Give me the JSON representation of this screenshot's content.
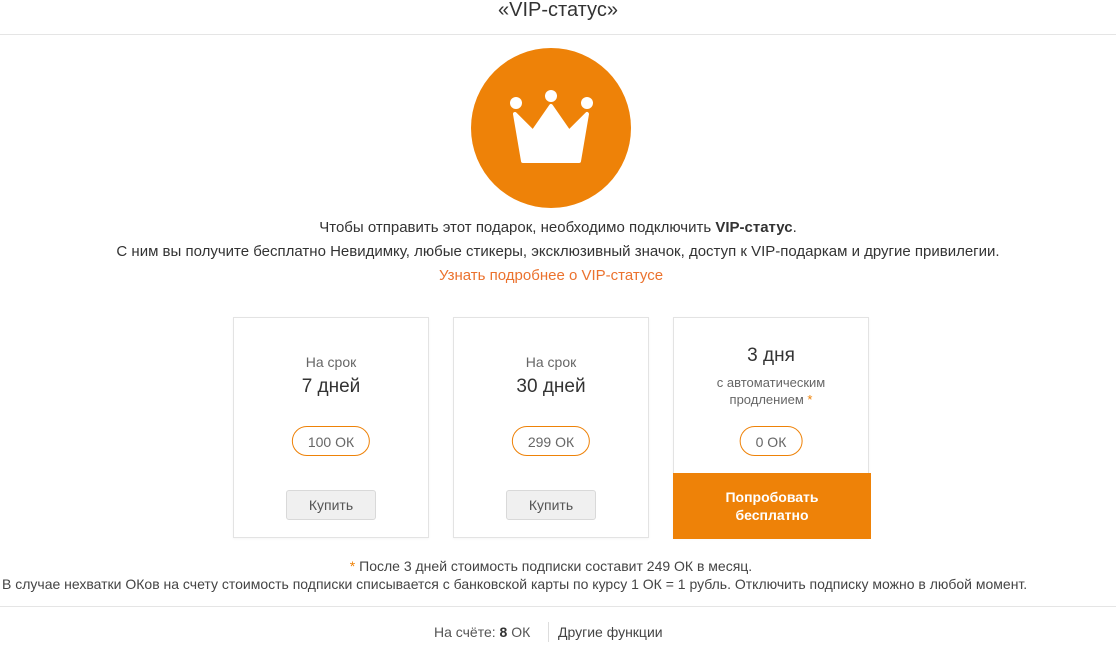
{
  "header": {
    "title": "«VIP-статус»"
  },
  "icon": {
    "name": "crown-icon",
    "bg_color": "#ee8208"
  },
  "info": {
    "line1_prefix": "Чтобы отправить этот подарок, необходимо подключить ",
    "line1_bold": "VIP-статус",
    "line1_suffix": ".",
    "line2": "С ним вы получите бесплатно Невидимку, любые стикеры, эксклюзивный значок, доступ к VIP-подаркам и другие привилегии.",
    "link": "Узнать подробнее о VIP-статусе"
  },
  "plans": [
    {
      "label": "На срок",
      "term": "7 дней",
      "price": "100 ОК",
      "button": "Купить"
    },
    {
      "label": "На срок",
      "term": "30 дней",
      "price": "299 ОК",
      "button": "Купить"
    },
    {
      "term": "3 дня",
      "auto_line1": "с автоматическим",
      "auto_line2": "продлением",
      "star": "*",
      "price": "0 ОК",
      "button": "Попробовать бесплатно"
    }
  ],
  "note": {
    "star": "*",
    "text": " После 3 дней стоимость подписки составит 249 ОК в месяц."
  },
  "disclaimer": "В случае нехватки ОКов на счету стоимость подписки списывается с банковской карты по курсу 1 ОК = 1 рубль. Отключить подписку можно в любой момент.",
  "footer": {
    "balance_label": "На счёте: ",
    "balance_value": "8",
    "balance_unit": " ОК",
    "other": "Другие функции"
  },
  "colors": {
    "accent": "#ee8208",
    "link": "#eb722e"
  }
}
